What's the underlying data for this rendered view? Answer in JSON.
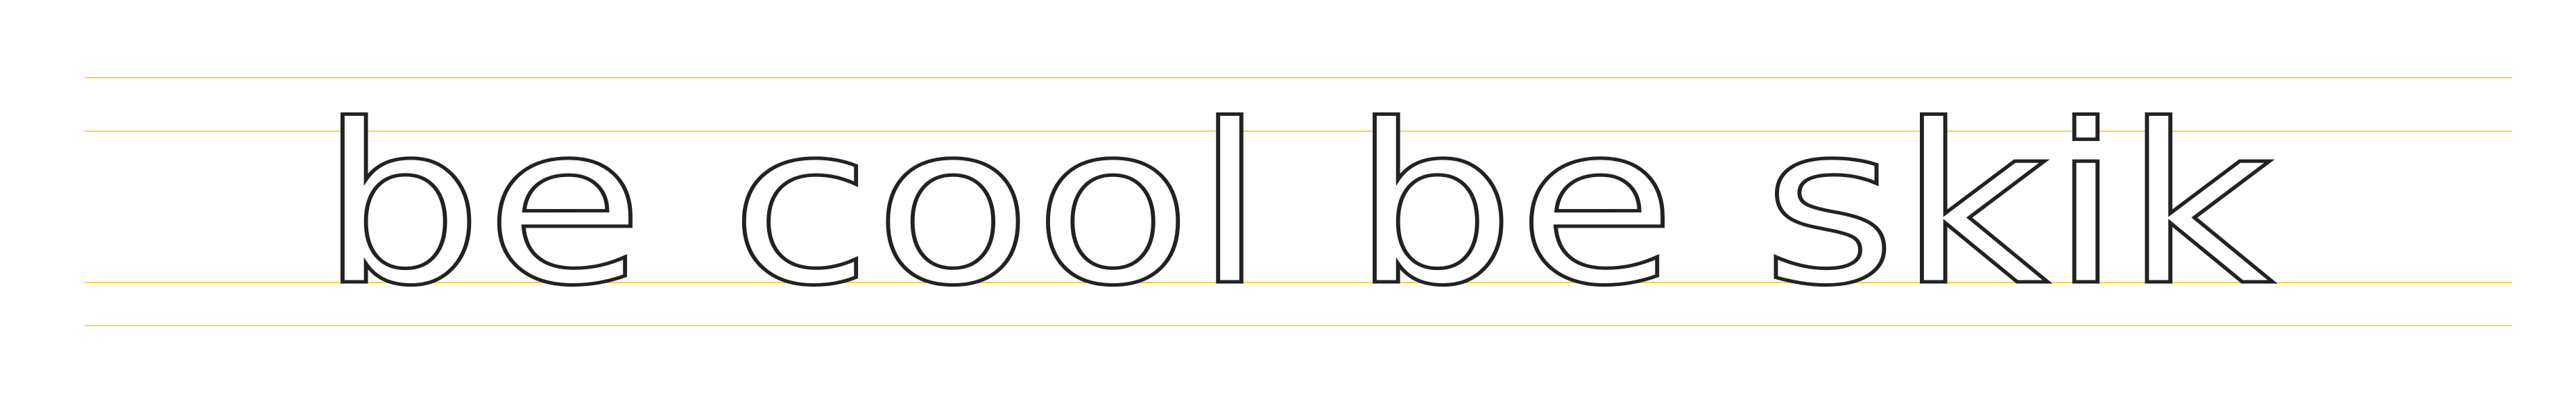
{
  "specimen": {
    "text": "be cool be skik",
    "ink_color": "#222222",
    "guide_color": "#f2d64a",
    "background": "#ffffff"
  }
}
